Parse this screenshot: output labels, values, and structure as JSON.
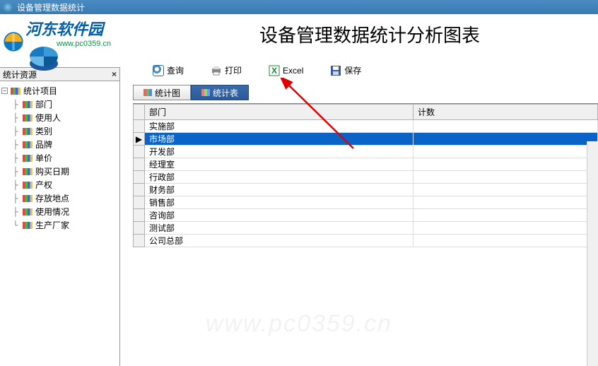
{
  "window": {
    "title": "设备管理数据统计"
  },
  "logo": {
    "text": "河东软件园",
    "url": "www.pc0359.cn"
  },
  "header": {
    "title": "设备管理数据统计分析图表"
  },
  "sidebar": {
    "header": "统计资源",
    "root": "统计项目",
    "items": [
      {
        "label": "部门"
      },
      {
        "label": "使用人"
      },
      {
        "label": "类别"
      },
      {
        "label": "品牌"
      },
      {
        "label": "单价"
      },
      {
        "label": "购买日期"
      },
      {
        "label": "产权"
      },
      {
        "label": "存放地点"
      },
      {
        "label": "使用情况"
      },
      {
        "label": "生产厂家"
      }
    ]
  },
  "toolbar": {
    "query": "查询",
    "print": "打印",
    "excel": "Excel",
    "save": "保存"
  },
  "tabs": {
    "chart": "统计图",
    "table": "统计表"
  },
  "grid": {
    "col_dept": "部门",
    "col_count": "计数",
    "rows": [
      {
        "dept": "实施部"
      },
      {
        "dept": "市场部",
        "selected": true
      },
      {
        "dept": "开发部"
      },
      {
        "dept": "经理室"
      },
      {
        "dept": "行政部"
      },
      {
        "dept": "财务部"
      },
      {
        "dept": "销售部"
      },
      {
        "dept": "咨询部"
      },
      {
        "dept": "测试部"
      },
      {
        "dept": "公司总部"
      }
    ]
  },
  "watermark": "www.pc0359.cn"
}
